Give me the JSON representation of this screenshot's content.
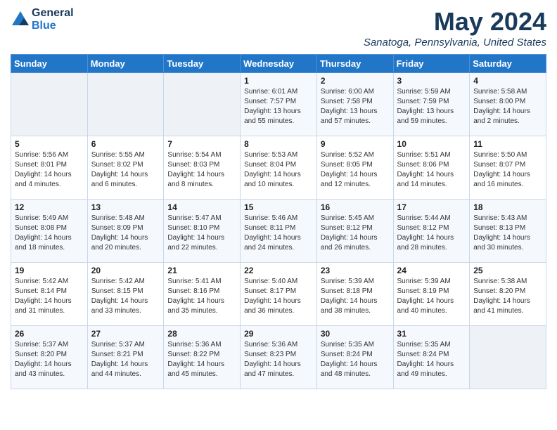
{
  "logo": {
    "line1": "General",
    "line2": "Blue"
  },
  "title": "May 2024",
  "location": "Sanatoga, Pennsylvania, United States",
  "days_of_week": [
    "Sunday",
    "Monday",
    "Tuesday",
    "Wednesday",
    "Thursday",
    "Friday",
    "Saturday"
  ],
  "weeks": [
    [
      {
        "day": "",
        "content": ""
      },
      {
        "day": "",
        "content": ""
      },
      {
        "day": "",
        "content": ""
      },
      {
        "day": "1",
        "content": "Sunrise: 6:01 AM\nSunset: 7:57 PM\nDaylight: 13 hours\nand 55 minutes."
      },
      {
        "day": "2",
        "content": "Sunrise: 6:00 AM\nSunset: 7:58 PM\nDaylight: 13 hours\nand 57 minutes."
      },
      {
        "day": "3",
        "content": "Sunrise: 5:59 AM\nSunset: 7:59 PM\nDaylight: 13 hours\nand 59 minutes."
      },
      {
        "day": "4",
        "content": "Sunrise: 5:58 AM\nSunset: 8:00 PM\nDaylight: 14 hours\nand 2 minutes."
      }
    ],
    [
      {
        "day": "5",
        "content": "Sunrise: 5:56 AM\nSunset: 8:01 PM\nDaylight: 14 hours\nand 4 minutes."
      },
      {
        "day": "6",
        "content": "Sunrise: 5:55 AM\nSunset: 8:02 PM\nDaylight: 14 hours\nand 6 minutes."
      },
      {
        "day": "7",
        "content": "Sunrise: 5:54 AM\nSunset: 8:03 PM\nDaylight: 14 hours\nand 8 minutes."
      },
      {
        "day": "8",
        "content": "Sunrise: 5:53 AM\nSunset: 8:04 PM\nDaylight: 14 hours\nand 10 minutes."
      },
      {
        "day": "9",
        "content": "Sunrise: 5:52 AM\nSunset: 8:05 PM\nDaylight: 14 hours\nand 12 minutes."
      },
      {
        "day": "10",
        "content": "Sunrise: 5:51 AM\nSunset: 8:06 PM\nDaylight: 14 hours\nand 14 minutes."
      },
      {
        "day": "11",
        "content": "Sunrise: 5:50 AM\nSunset: 8:07 PM\nDaylight: 14 hours\nand 16 minutes."
      }
    ],
    [
      {
        "day": "12",
        "content": "Sunrise: 5:49 AM\nSunset: 8:08 PM\nDaylight: 14 hours\nand 18 minutes."
      },
      {
        "day": "13",
        "content": "Sunrise: 5:48 AM\nSunset: 8:09 PM\nDaylight: 14 hours\nand 20 minutes."
      },
      {
        "day": "14",
        "content": "Sunrise: 5:47 AM\nSunset: 8:10 PM\nDaylight: 14 hours\nand 22 minutes."
      },
      {
        "day": "15",
        "content": "Sunrise: 5:46 AM\nSunset: 8:11 PM\nDaylight: 14 hours\nand 24 minutes."
      },
      {
        "day": "16",
        "content": "Sunrise: 5:45 AM\nSunset: 8:12 PM\nDaylight: 14 hours\nand 26 minutes."
      },
      {
        "day": "17",
        "content": "Sunrise: 5:44 AM\nSunset: 8:12 PM\nDaylight: 14 hours\nand 28 minutes."
      },
      {
        "day": "18",
        "content": "Sunrise: 5:43 AM\nSunset: 8:13 PM\nDaylight: 14 hours\nand 30 minutes."
      }
    ],
    [
      {
        "day": "19",
        "content": "Sunrise: 5:42 AM\nSunset: 8:14 PM\nDaylight: 14 hours\nand 31 minutes."
      },
      {
        "day": "20",
        "content": "Sunrise: 5:42 AM\nSunset: 8:15 PM\nDaylight: 14 hours\nand 33 minutes."
      },
      {
        "day": "21",
        "content": "Sunrise: 5:41 AM\nSunset: 8:16 PM\nDaylight: 14 hours\nand 35 minutes."
      },
      {
        "day": "22",
        "content": "Sunrise: 5:40 AM\nSunset: 8:17 PM\nDaylight: 14 hours\nand 36 minutes."
      },
      {
        "day": "23",
        "content": "Sunrise: 5:39 AM\nSunset: 8:18 PM\nDaylight: 14 hours\nand 38 minutes."
      },
      {
        "day": "24",
        "content": "Sunrise: 5:39 AM\nSunset: 8:19 PM\nDaylight: 14 hours\nand 40 minutes."
      },
      {
        "day": "25",
        "content": "Sunrise: 5:38 AM\nSunset: 8:20 PM\nDaylight: 14 hours\nand 41 minutes."
      }
    ],
    [
      {
        "day": "26",
        "content": "Sunrise: 5:37 AM\nSunset: 8:20 PM\nDaylight: 14 hours\nand 43 minutes."
      },
      {
        "day": "27",
        "content": "Sunrise: 5:37 AM\nSunset: 8:21 PM\nDaylight: 14 hours\nand 44 minutes."
      },
      {
        "day": "28",
        "content": "Sunrise: 5:36 AM\nSunset: 8:22 PM\nDaylight: 14 hours\nand 45 minutes."
      },
      {
        "day": "29",
        "content": "Sunrise: 5:36 AM\nSunset: 8:23 PM\nDaylight: 14 hours\nand 47 minutes."
      },
      {
        "day": "30",
        "content": "Sunrise: 5:35 AM\nSunset: 8:24 PM\nDaylight: 14 hours\nand 48 minutes."
      },
      {
        "day": "31",
        "content": "Sunrise: 5:35 AM\nSunset: 8:24 PM\nDaylight: 14 hours\nand 49 minutes."
      },
      {
        "day": "",
        "content": ""
      }
    ]
  ]
}
